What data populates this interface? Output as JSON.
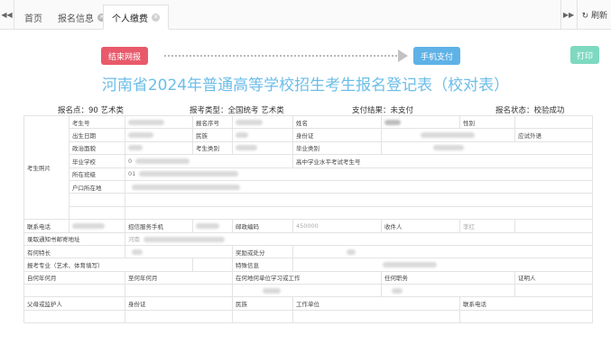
{
  "tabbar": {
    "prev_icon": "double-left-arrow",
    "next_icon": "double-right-arrow",
    "refresh_icon": "refresh",
    "refresh_label": "刷新",
    "tabs": [
      {
        "label": "首页"
      },
      {
        "label": "报名信息"
      },
      {
        "label": "个人缴费"
      }
    ],
    "close_icon": "close-circle"
  },
  "actions": {
    "end_label": "结束网报",
    "pay_label": "手机支付",
    "print_label": "打印"
  },
  "colors": {
    "end_button": "#e85a6b",
    "pay_button": "#5fb2e6",
    "print_button": "#7ed9c1",
    "title": "#6cbde8"
  },
  "form": {
    "title": "河南省2024年普通高等学校招生考生报名登记表（校对表）",
    "site": "报名点：90 艺术类",
    "exam_type": "报考类型：全国统考 艺术类",
    "pay_result": "支付结果：未支付",
    "status": "报名状态：校验成功"
  },
  "table": {
    "photo_label": "考生照片",
    "exam_no": "考生号",
    "reg_no": "报名序号",
    "name": "姓名",
    "gender": "性别",
    "birth": "出生日期",
    "ethnic": "民族",
    "id": "身份证",
    "lang": "应试外语",
    "politics": "政治面貌",
    "cand_type": "考生类别",
    "grad_type": "毕业类别",
    "school": "毕业学校",
    "school_val": "0",
    "hs_no": "高中学业水平考试考生号",
    "class": "所在班级",
    "class_val": "01",
    "hukou": "户口所在地",
    "hukou_val": "",
    "phone": "联系电话",
    "recv_phone": "招信服务手机",
    "zip": "邮政编码",
    "zip_val": "450000",
    "recv": "收件人",
    "recv_val": "李红",
    "mail_addr": "录取通知书邮寄地址",
    "mail_val": "河南",
    "talent": "有何特长",
    "award": "奖励或处分",
    "major": "报考专业（艺术、体育填写）",
    "prep": "特殊信息",
    "from_ym": "自何年何月",
    "to_ym": "至何年何月",
    "work_where": "在何地何单位学习或工作",
    "position": "任何职务",
    "witness": "证明人",
    "guardian": "父母或监护人",
    "guardian_id": "身份证",
    "guardian_eth": "民族",
    "work_unit": "工作单位",
    "guardian_phone": "联系电话"
  }
}
